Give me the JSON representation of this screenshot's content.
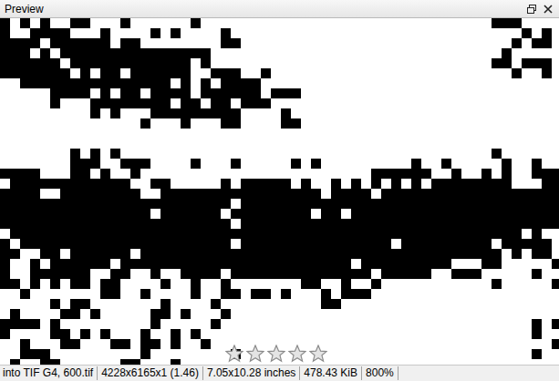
{
  "window": {
    "title": "Preview"
  },
  "preview": {
    "rating": {
      "stars": 0,
      "max": 5
    }
  },
  "status_bar": [
    "into TIF G4, 600.tif",
    "4228x6165x1 (1.46)",
    "7.05x10.28 inches",
    "478.43 KiB",
    "800%"
  ]
}
